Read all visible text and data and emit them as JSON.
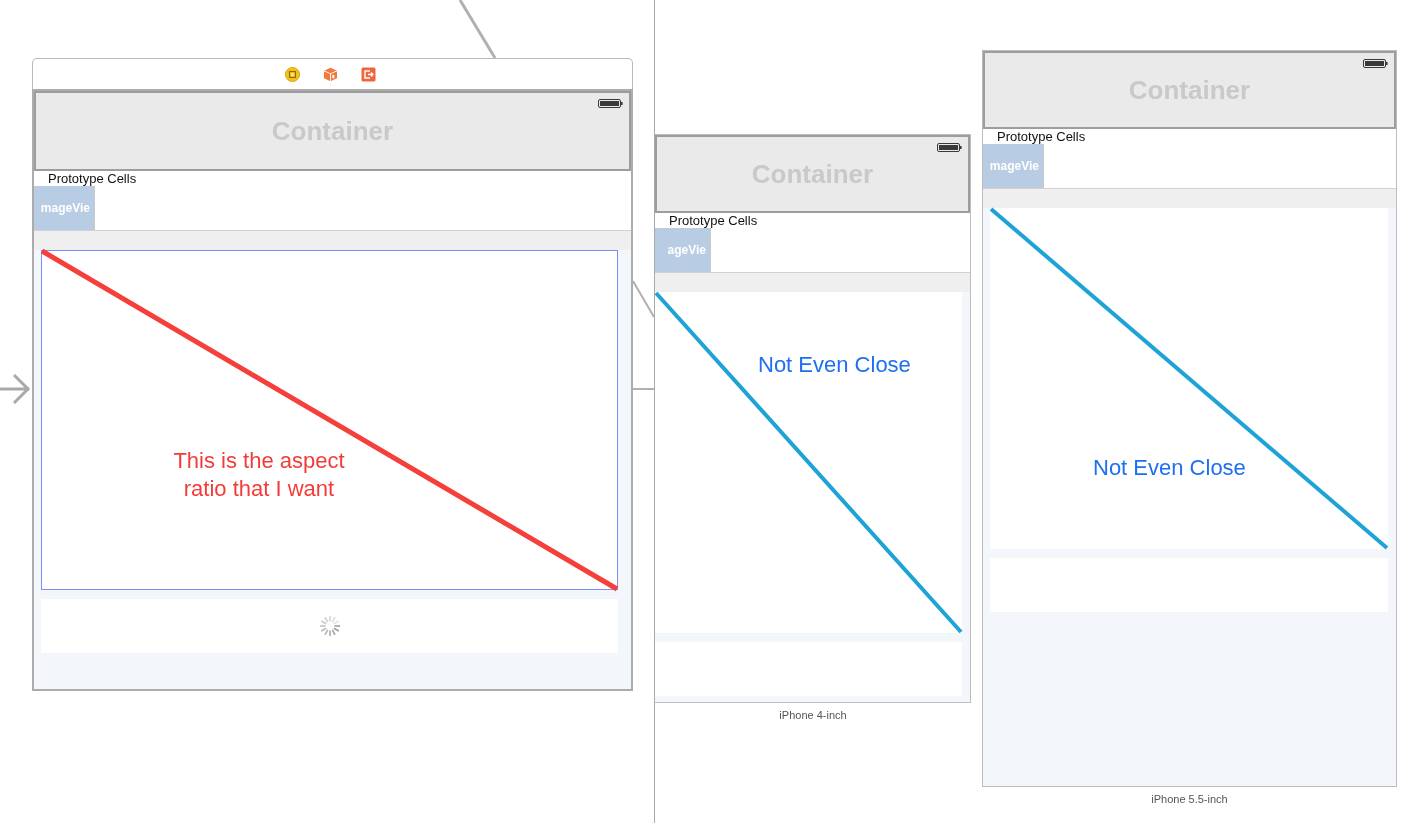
{
  "canvas": {
    "scenes": [
      {
        "kind": "editor",
        "selected": true,
        "loading": true,
        "container_title": "Container",
        "section_header": "Prototype Cells",
        "image_cell_label": "mageVie",
        "annotation": "This is the aspect ratio that I want"
      },
      {
        "kind": "preview",
        "selected": false,
        "loading": false,
        "container_title": "Container",
        "section_header": "Prototype Cells",
        "image_cell_label": "ageVie",
        "annotation": "Not Even Close",
        "device_label": "iPhone 4-inch"
      },
      {
        "kind": "preview",
        "selected": false,
        "loading": false,
        "container_title": "Container",
        "section_header": "Prototype Cells",
        "image_cell_label": "mageVie",
        "annotation": "Not Even Close",
        "device_label": "iPhone 5.5-inch"
      }
    ]
  }
}
